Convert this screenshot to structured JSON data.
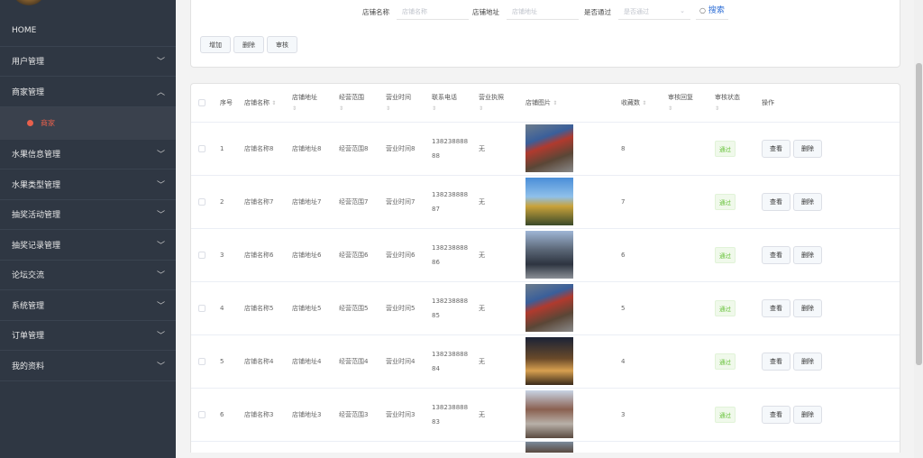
{
  "sidebar": {
    "items": [
      {
        "label": "HOME",
        "chevron": ""
      },
      {
        "label": "用户管理",
        "chevron": "down"
      },
      {
        "label": "商家管理",
        "chevron": "up",
        "sub": "商家"
      },
      {
        "label": "水果信息管理",
        "chevron": "down"
      },
      {
        "label": "水果类型管理",
        "chevron": "down"
      },
      {
        "label": "抽奖活动管理",
        "chevron": "down"
      },
      {
        "label": "抽奖记录管理",
        "chevron": "down"
      },
      {
        "label": "论坛交流",
        "chevron": "down"
      },
      {
        "label": "系统管理",
        "chevron": "down"
      },
      {
        "label": "订单管理",
        "chevron": "down"
      },
      {
        "label": "我的资料",
        "chevron": "down"
      }
    ]
  },
  "search": {
    "name_label": "店铺名称",
    "name_placeholder": "店铺名称",
    "addr_label": "店铺地址",
    "addr_placeholder": "店铺地址",
    "pass_label": "是否通过",
    "pass_placeholder": "是否通过",
    "search_label": "搜索"
  },
  "toolbar": {
    "add": "增加",
    "delete": "删除",
    "audit": "审核"
  },
  "table": {
    "headers": [
      "序号",
      "店铺名称",
      "店铺地址",
      "经营范围",
      "营业时间",
      "联系电话",
      "营业执照",
      "店铺图片",
      "收藏数",
      "审核回复",
      "审核状态",
      "操作"
    ],
    "view_label": "查看",
    "delete_label": "删除",
    "rows": [
      {
        "no": "1",
        "name": "店铺名称8",
        "addr": "店铺地址8",
        "scope": "经营范围8",
        "time": "营业时间8",
        "phone": "13823888888",
        "license": "无",
        "fav": "8",
        "reply": "",
        "status": "通过"
      },
      {
        "no": "2",
        "name": "店铺名称7",
        "addr": "店铺地址7",
        "scope": "经营范围7",
        "time": "营业时间7",
        "phone": "13823888887",
        "license": "无",
        "fav": "7",
        "reply": "",
        "status": "通过"
      },
      {
        "no": "3",
        "name": "店铺名称6",
        "addr": "店铺地址6",
        "scope": "经营范围6",
        "time": "营业时间6",
        "phone": "13823888886",
        "license": "无",
        "fav": "6",
        "reply": "",
        "status": "通过"
      },
      {
        "no": "4",
        "name": "店铺名称5",
        "addr": "店铺地址5",
        "scope": "经营范围5",
        "time": "营业时间5",
        "phone": "13823888885",
        "license": "无",
        "fav": "5",
        "reply": "",
        "status": "通过"
      },
      {
        "no": "5",
        "name": "店铺名称4",
        "addr": "店铺地址4",
        "scope": "经营范围4",
        "time": "营业时间4",
        "phone": "13823888884",
        "license": "无",
        "fav": "4",
        "reply": "",
        "status": "通过"
      },
      {
        "no": "6",
        "name": "店铺名称3",
        "addr": "店铺地址3",
        "scope": "经营范围3",
        "time": "营业时间3",
        "phone": "13823888883",
        "license": "无",
        "fav": "3",
        "reply": "",
        "status": "通过"
      }
    ]
  }
}
